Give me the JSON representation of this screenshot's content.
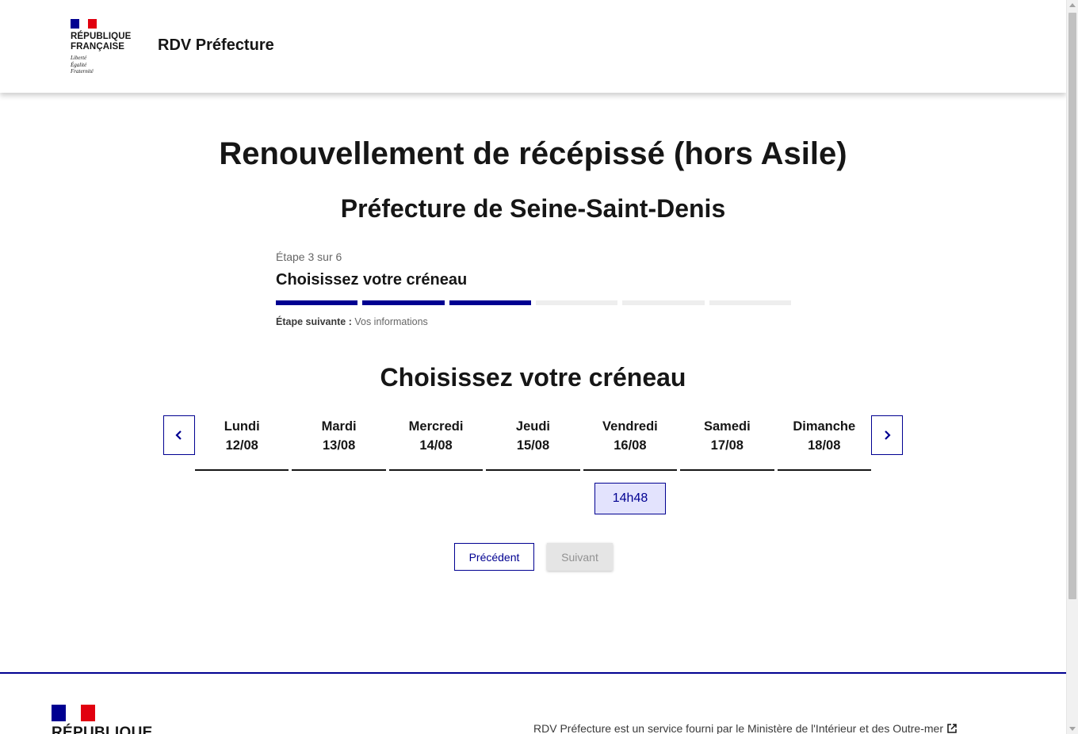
{
  "header": {
    "logo_line1": "RÉPUBLIQUE",
    "logo_line2": "FRANÇAISE",
    "devise_1": "Liberté",
    "devise_2": "Égalité",
    "devise_3": "Fraternité",
    "service_title": "RDV Préfecture"
  },
  "page": {
    "title": "Renouvellement de récépissé (hors Asile)",
    "subtitle": "Préfecture de Seine-Saint-Denis"
  },
  "stepper": {
    "state": "Étape 3 sur 6",
    "current_step": 3,
    "total_steps": 6,
    "title": "Choisissez votre créneau",
    "next_label": "Étape suivante :",
    "next_value": "Vos informations"
  },
  "slots": {
    "title": "Choisissez votre créneau",
    "days": [
      {
        "name": "Lundi",
        "date": "12/08"
      },
      {
        "name": "Mardi",
        "date": "13/08"
      },
      {
        "name": "Mercredi",
        "date": "14/08"
      },
      {
        "name": "Jeudi",
        "date": "15/08"
      },
      {
        "name": "Vendredi",
        "date": "16/08"
      },
      {
        "name": "Samedi",
        "date": "17/08"
      },
      {
        "name": "Dimanche",
        "date": "18/08"
      }
    ],
    "available_slot": "14h48"
  },
  "actions": {
    "prev_label": "Précédent",
    "next_label": "Suivant"
  },
  "footer": {
    "republic": "RÉPUBLIQUE",
    "description": "RDV Préfecture est un service fourni par le Ministère de l'Intérieur et des Outre-mer"
  },
  "colors": {
    "primary": "#000091",
    "marianne_red": "#e1000f",
    "slot_bg": "#e3e3fd"
  }
}
